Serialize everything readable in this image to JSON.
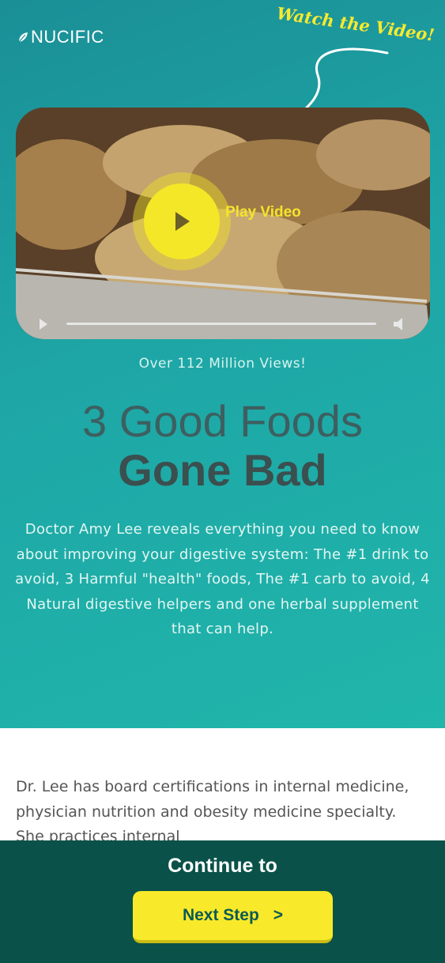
{
  "header": {
    "logo_text": "NUCIFIC",
    "watch_callout": "Watch the Video!"
  },
  "video": {
    "play_label": "Play Video",
    "views_text": "Over 112 Million Views!"
  },
  "headline": {
    "line1": "3 Good Foods",
    "line2": "Gone Bad"
  },
  "description": "Doctor Amy Lee reveals everything you need to know about improving your digestive system: The #1 drink to avoid, 3 Harmful \"health\" foods, The #1 carb to avoid, 4 Natural digestive helpers and one herbal supplement that can help.",
  "bio": {
    "text": "Dr. Lee has board certifications in internal medicine, physician nutrition and obesity medicine specialty. She practices internal"
  },
  "cta": {
    "continue_text": "Continue to",
    "button_label": "Next Step",
    "button_chevron": ">"
  },
  "colors": {
    "hero_teal": "#1ea6a6",
    "accent_yellow": "#f8ea2a",
    "footer_green": "#0a5249"
  }
}
